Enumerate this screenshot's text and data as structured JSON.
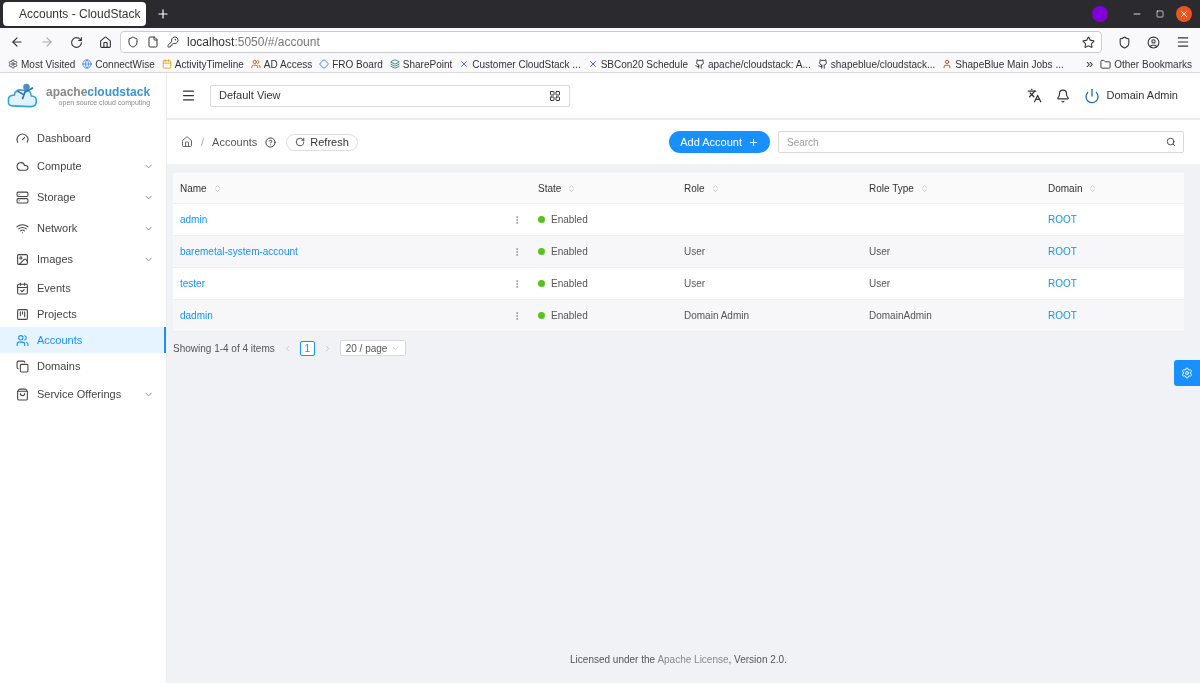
{
  "browser": {
    "tab_title": "Accounts - CloudStack",
    "url_host": "localhost",
    "url_rest": ":5050/#/account",
    "bookmarks": [
      {
        "label": "Most Visited"
      },
      {
        "label": "ConnectWise"
      },
      {
        "label": "ActivityTimeline"
      },
      {
        "label": "AD Access"
      },
      {
        "label": "FRO Board"
      },
      {
        "label": "SharePoint"
      },
      {
        "label": "Customer CloudStack ..."
      },
      {
        "label": "SBCon20 Schedule"
      },
      {
        "label": "apache/cloudstack: A..."
      },
      {
        "label": "shapeblue/cloudstack..."
      },
      {
        "label": "ShapeBlue Main Jobs ..."
      }
    ],
    "overflow": "»",
    "other_bookmarks": "Other Bookmarks"
  },
  "logo": {
    "name_a": "apache",
    "name_b": "cloudstack",
    "tagline": "open source cloud computing"
  },
  "header": {
    "view": "Default View",
    "user": "Domain Admin"
  },
  "sidebar": {
    "items": [
      {
        "label": "Dashboard",
        "expandable": false,
        "selected": false
      },
      {
        "label": "Compute",
        "expandable": true,
        "selected": false
      },
      {
        "label": "Storage",
        "expandable": true,
        "selected": false
      },
      {
        "label": "Network",
        "expandable": true,
        "selected": false
      },
      {
        "label": "Images",
        "expandable": true,
        "selected": false
      },
      {
        "label": "Events",
        "expandable": false,
        "selected": false
      },
      {
        "label": "Projects",
        "expandable": false,
        "selected": false
      },
      {
        "label": "Accounts",
        "expandable": false,
        "selected": true
      },
      {
        "label": "Domains",
        "expandable": false,
        "selected": false
      },
      {
        "label": "Service Offerings",
        "expandable": true,
        "selected": false
      }
    ]
  },
  "breadcrumb": {
    "separator": "/",
    "current": "Accounts",
    "refresh": "Refresh"
  },
  "add_button": "Add Account",
  "search": {
    "placeholder": "Search"
  },
  "table": {
    "columns": [
      "Name",
      "State",
      "Role",
      "Role Type",
      "Domain"
    ],
    "rows": [
      {
        "name": "admin",
        "state": "Enabled",
        "color": "#52c41a",
        "domain": "ROOT"
      },
      {
        "name": "baremetal-system-account",
        "state": "Enabled",
        "color": "#52c41a",
        "role": "User",
        "role_type": "User",
        "domain": "ROOT"
      },
      {
        "name": "tester",
        "state": "Enabled",
        "color": "#52c41a",
        "role": "User",
        "role_type": "User",
        "domain": "ROOT"
      },
      {
        "name": "dadmin",
        "state": "Enabled",
        "color": "#52c41a",
        "role": "Domain Admin",
        "role_type": "DomainAdmin",
        "domain": "ROOT"
      }
    ]
  },
  "pagination": {
    "showing": "Showing 1-4 of 4 items",
    "pages": [
      {
        "label": "1",
        "selected": true
      }
    ],
    "page_size": "20 / page"
  },
  "footer": {
    "prefix": "Licensed under the",
    "link": "Apache License",
    "suffix": ", Version 2.0."
  }
}
